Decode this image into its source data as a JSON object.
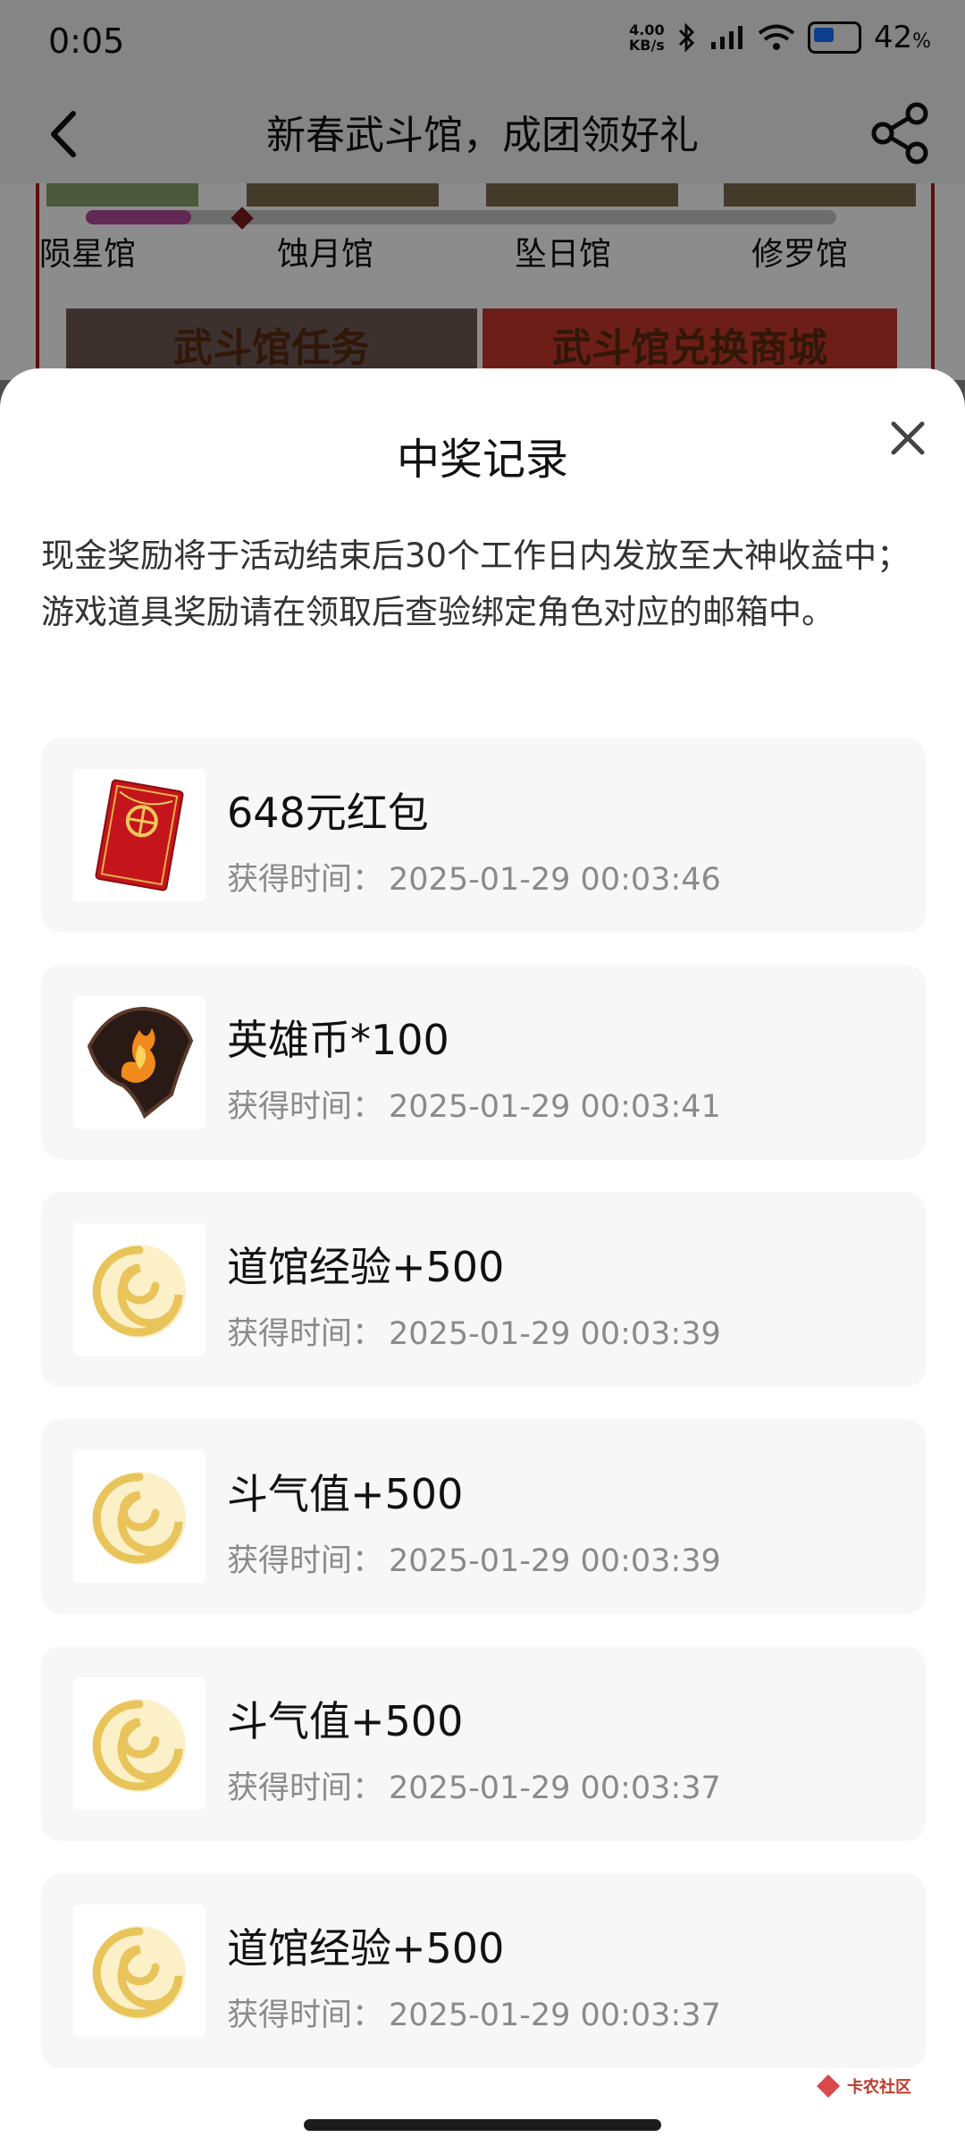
{
  "status_bar": {
    "time": "0:05",
    "net_speed_value": "4.00",
    "net_speed_unit": "KB/s",
    "battery": "42"
  },
  "header": {
    "title": "新春武斗馆，成团领好礼"
  },
  "background": {
    "halls": [
      "陨星馆",
      "蚀月馆",
      "坠日馆",
      "修罗馆"
    ],
    "progress": 0.14,
    "tab_tasks": "武斗馆任务",
    "tab_shop": "武斗馆兑换商城"
  },
  "sheet": {
    "title": "中奖记录",
    "notice": "现金奖励将于活动结束后30个工作日内发放至大神收益中；游戏道具奖励请在领取后查验绑定角色对应的邮箱中。",
    "time_label": "获得时间：",
    "records": [
      {
        "name": "648元红包",
        "time": "2025-01-29 00:03:46",
        "icon": "red-envelope-icon"
      },
      {
        "name": "英雄币*100",
        "time": "2025-01-29 00:03:41",
        "icon": "hero-coin-icon"
      },
      {
        "name": "道馆经验+500",
        "time": "2025-01-29 00:03:39",
        "icon": "swirl-orb-icon"
      },
      {
        "name": "斗气值+500",
        "time": "2025-01-29 00:03:39",
        "icon": "swirl-orb-icon"
      },
      {
        "name": "斗气值+500",
        "time": "2025-01-29 00:03:37",
        "icon": "swirl-orb-icon"
      },
      {
        "name": "道馆经验+500",
        "time": "2025-01-29 00:03:37",
        "icon": "swirl-orb-icon"
      }
    ]
  },
  "watermark": {
    "text": "卡农社区"
  },
  "colors": {
    "accent_red": "#b5161b",
    "progress_purple": "#b24c9a"
  }
}
